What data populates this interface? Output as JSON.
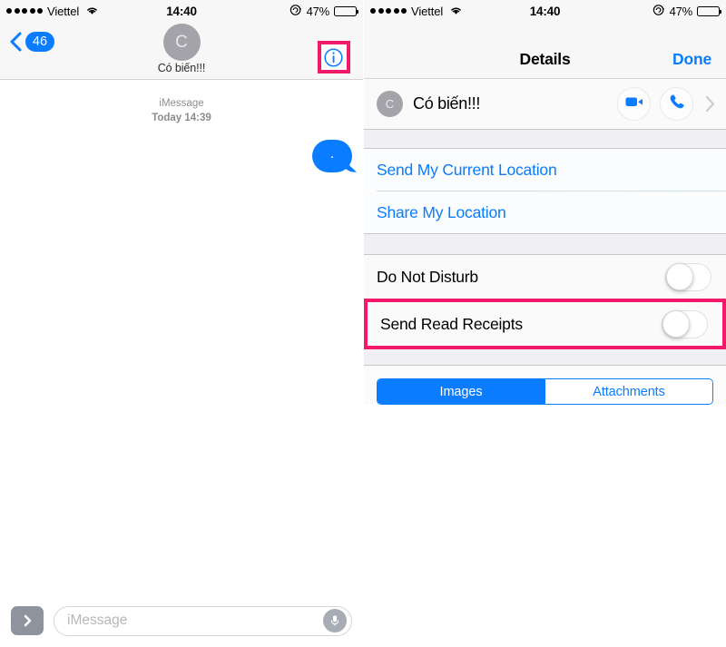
{
  "colors": {
    "accent": "#0a7cff",
    "highlight": "#f5186b",
    "group_bg": "#efeff4",
    "avatar": "#a3a3a9",
    "muted_text": "#8e8e93"
  },
  "status_bar": {
    "carrier": "Viettel",
    "signal_dots": 5,
    "wifi_icon": "wifi-icon",
    "time": "14:40",
    "rotation_lock_icon": "rotation-lock-icon",
    "battery_percent": "47%",
    "battery_level": 47
  },
  "left_panel": {
    "nav": {
      "back_badge": "46",
      "back_icon": "chevron-left-icon",
      "avatar_initial": "C",
      "contact_name": "Có biến!!!",
      "info_icon": "info-circle-icon",
      "info_highlighted": true
    },
    "conversation": {
      "service_label": "iMessage",
      "timestamp": "Today 14:39",
      "messages": [
        {
          "text": ".",
          "side": "outgoing"
        }
      ]
    },
    "toolbar": {
      "apps_icon": "app-drawer-chevron-icon",
      "input_placeholder": "iMessage",
      "input_value": "",
      "mic_icon": "microphone-icon"
    }
  },
  "right_panel": {
    "nav": {
      "title": "Details",
      "done_label": "Done"
    },
    "contact": {
      "avatar_initial": "C",
      "name": "Có biến!!!",
      "video_icon": "video-camera-icon",
      "phone_icon": "phone-icon",
      "disclosure_icon": "chevron-right-icon"
    },
    "location_rows": [
      {
        "label": "Send My Current Location",
        "name": "send-my-current-location"
      },
      {
        "label": "Share My Location",
        "name": "share-my-location"
      }
    ],
    "toggle_rows": [
      {
        "label": "Do Not Disturb",
        "name": "do-not-disturb",
        "value": "off",
        "highlighted": false
      },
      {
        "label": "Send Read Receipts",
        "name": "send-read-receipts",
        "value": "off",
        "highlighted": true
      }
    ],
    "segmented_control": {
      "options": [
        {
          "label": "Images",
          "selected": true
        },
        {
          "label": "Attachments",
          "selected": false
        }
      ]
    }
  }
}
